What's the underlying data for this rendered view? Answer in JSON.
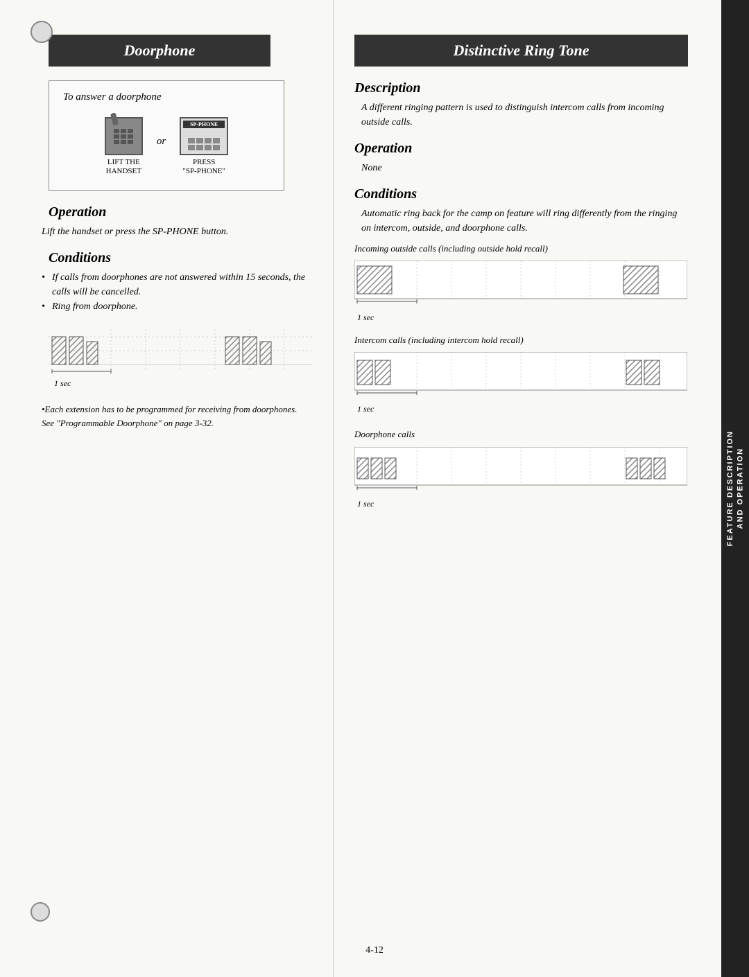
{
  "page": {
    "number": "4-12",
    "left": {
      "header": "Doorphone",
      "instruction_box": {
        "text": "To answer a doorphone",
        "or": "or",
        "left_label": "LIFT THE\nHANDSET",
        "right_label": "PRESS\n\"SP-PHONE\"",
        "sp_phone_label": "SP-PHONE"
      },
      "operation": {
        "title": "Operation",
        "body": "Lift the handset or press the SP-PHONE button."
      },
      "conditions": {
        "title": "Conditions",
        "bullets": [
          "If calls from doorphones are not answered within 15 seconds, the calls will be cancelled.",
          "Ring from doorphone."
        ]
      },
      "note": "•Each extension has to be programmed for receiving from doorphones. See \"Programmable Doorphone\" on page 3-32."
    },
    "right": {
      "header": "Distinctive Ring Tone",
      "description": {
        "title": "Description",
        "body": "A different ringing pattern is used to distinguish intercom calls from incoming outside calls."
      },
      "operation": {
        "title": "Operation",
        "body": "None"
      },
      "conditions": {
        "title": "Conditions",
        "body": "Automatic ring back for the camp on feature will ring differently from the ringing on intercom, outside, and doorphone calls.",
        "incoming_label": "Incoming outside calls (including outside hold recall)",
        "incoming_sec": "1 sec",
        "intercom_label": "Intercom calls (including intercom hold recall)",
        "intercom_sec": "1 sec",
        "doorphone_label": "Doorphone calls",
        "doorphone_sec": "1 sec"
      }
    },
    "sidebar": {
      "label": "FEATURE DESCRIPTION\nAND OPERATION"
    }
  }
}
